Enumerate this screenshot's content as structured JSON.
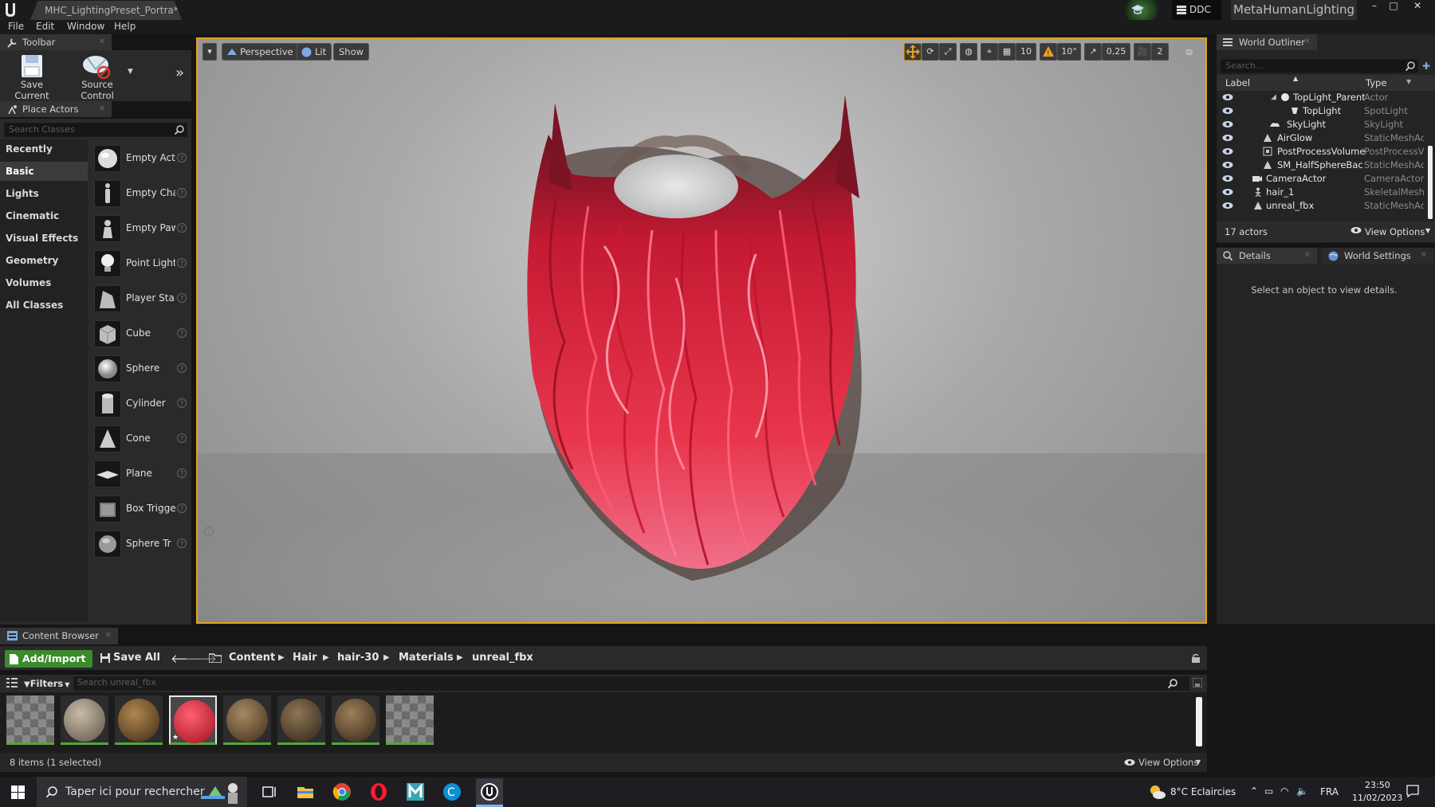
{
  "title_bar": {
    "document_tab": "MHC_LightingPreset_Portra*",
    "ddc_label": "DDC",
    "project_name": "MetaHumanLighting",
    "minimize": "–",
    "maximize": "□",
    "close": "✕"
  },
  "menu": [
    "File",
    "Edit",
    "Window",
    "Help"
  ],
  "toolbar_panel": {
    "tab_label": "Toolbar",
    "save_current": "Save Current",
    "source_control": "Source Control"
  },
  "place_actors": {
    "tab_label": "Place Actors",
    "search_placeholder": "Search Classes",
    "categories": [
      "Recently Placed",
      "Basic",
      "Lights",
      "Cinematic",
      "Visual Effects",
      "Geometry",
      "Volumes",
      "All Classes"
    ],
    "active_category": "Basic",
    "actors": [
      "Empty Act",
      "Empty Cha",
      "Empty Paw",
      "Point Light",
      "Player Sta",
      "Cube",
      "Sphere",
      "Cylinder",
      "Cone",
      "Plane",
      "Box Trigge",
      "Sphere Tr"
    ]
  },
  "viewport": {
    "perspective_label": "Perspective",
    "lit_label": "Lit",
    "show_label": "Show",
    "grid_snap": "10",
    "rotation_snap": "10°",
    "scale_snap": "0,25",
    "camera_speed": "2"
  },
  "world_outliner": {
    "tab_label": "World Outliner",
    "search_placeholder": "Search...",
    "col_label": "Label",
    "col_type": "Type",
    "rows": [
      {
        "label": "TopLight_Parent",
        "type": "Actor"
      },
      {
        "label": "TopLight",
        "type": "SpotLight"
      },
      {
        "label": "SkyLight",
        "type": "SkyLight"
      },
      {
        "label": "AirGlow",
        "type": "StaticMeshAc"
      },
      {
        "label": "PostProcessVolume",
        "type": "PostProcessV"
      },
      {
        "label": "SM_HalfSphereBackg",
        "type": "StaticMeshAc"
      },
      {
        "label": "CameraActor",
        "type": "CameraActor"
      },
      {
        "label": "hair_1",
        "type": "SkeletalMesh"
      },
      {
        "label": "unreal_fbx",
        "type": "StaticMeshAc"
      }
    ],
    "actor_count": "17 actors",
    "view_options": "View Options"
  },
  "details": {
    "tab_label": "Details",
    "world_settings_tab": "World Settings",
    "empty_message": "Select an object to view details."
  },
  "content_browser": {
    "tab_label": "Content Browser",
    "add_import": "Add/Import",
    "save_all": "Save All",
    "breadcrumb": [
      "Content",
      "Hair",
      "hair-30",
      "Materials",
      "unreal_fbx"
    ],
    "filters_label": "Filters",
    "search_placeholder": "Search unreal_fbx",
    "status": "8 items (1 selected)",
    "view_options": "View Options"
  },
  "taskbar": {
    "search_placeholder": "Taper ici pour rechercher",
    "weather": "8°C  Eclaircies",
    "language": "FRA",
    "time": "23:50",
    "date": "11/02/2023"
  },
  "colors": {
    "viewport_border": "#e0a21c",
    "add_import_green": "#3b8a2c",
    "hair_red": "#d8213a"
  }
}
